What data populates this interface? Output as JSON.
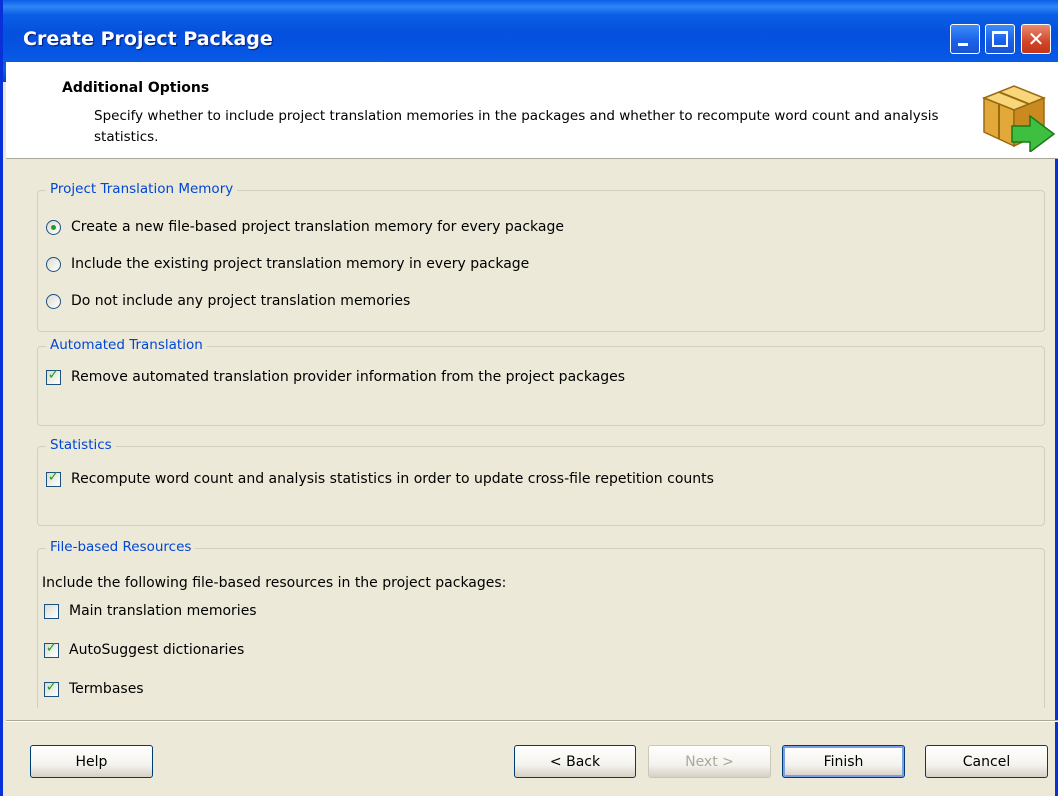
{
  "window": {
    "title": "Create Project Package"
  },
  "header": {
    "title": "Additional Options",
    "description": "Specify whether to include project translation memories in the packages and whether to recompute word count and analysis statistics.",
    "icon": "package-arrow-icon"
  },
  "groups": {
    "project_tm": {
      "legend": "Project Translation Memory",
      "options": [
        {
          "label": "Create a new file-based project translation memory for every package",
          "selected": true
        },
        {
          "label": "Include the existing project translation memory in every package",
          "selected": false
        },
        {
          "label": "Do not include any project translation memories",
          "selected": false
        }
      ]
    },
    "automated_translation": {
      "legend": "Automated Translation",
      "checkbox": {
        "label": "Remove automated translation provider information from the project packages",
        "checked": true
      }
    },
    "statistics": {
      "legend": "Statistics",
      "checkbox": {
        "label": "Recompute word count and analysis statistics in order to update cross-file repetition counts",
        "checked": true
      }
    },
    "file_resources": {
      "legend": "File-based Resources",
      "intro": "Include the following file-based resources in the project packages:",
      "items": [
        {
          "label": "Main translation memories",
          "checked": false
        },
        {
          "label": "AutoSuggest dictionaries",
          "checked": true
        },
        {
          "label": "Termbases",
          "checked": true
        }
      ]
    }
  },
  "buttons": {
    "help": "Help",
    "back": "< Back",
    "next": "Next >",
    "finish": "Finish",
    "cancel": "Cancel"
  },
  "colors": {
    "titlebar": "#0a5fe6",
    "legend_text": "#0046d5",
    "check_mark": "#21a121"
  }
}
